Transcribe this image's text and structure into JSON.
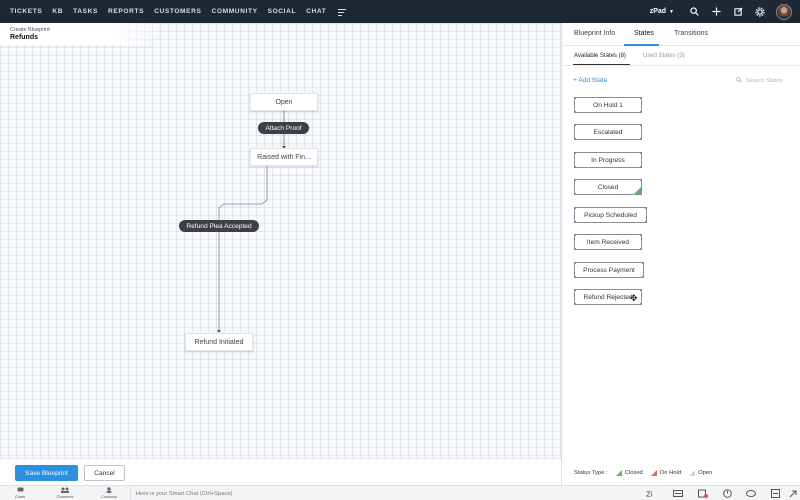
{
  "topnav": {
    "items": [
      "TICKETS",
      "KB",
      "TASKS",
      "REPORTS",
      "CUSTOMERS",
      "COMMUNITY",
      "SOCIAL",
      "CHAT"
    ],
    "portal_name": "zPad",
    "icons": [
      "menu-icon",
      "search-icon",
      "plus-icon",
      "share-icon",
      "gear-icon",
      "avatar"
    ]
  },
  "breadcrumb": {
    "section": "Create Blueprint",
    "title": "Refunds"
  },
  "canvas": {
    "nodes": {
      "open": "Open",
      "raised": "Raised with Fin...",
      "refund_initiated": "Refund Initiated"
    },
    "transitions": {
      "attach_proof": "Attach Proof",
      "refund_plea": "Refund Plea Accepted"
    }
  },
  "actions": {
    "save": "Save Blueprint",
    "cancel": "Cancel"
  },
  "panel": {
    "tabs": [
      "Blueprint Info",
      "States",
      "Transitions"
    ],
    "active_tab": "States",
    "sub_tabs": {
      "available": "Available States (8)",
      "used": "Used States (3)"
    },
    "add_state": "+ Add State",
    "search_placeholder": "Search States",
    "states": [
      "On Hold 1",
      "Escalated",
      "In Progress",
      "Closed",
      "Pickup Scheduled",
      "Item Received",
      "Process Payment",
      "Refund Rejected"
    ],
    "legend": {
      "label": "Status Type :",
      "closed": "Closed",
      "on_hold": "On Hold",
      "open": "Open"
    },
    "colors": {
      "closed": "#5cb85c",
      "on_hold": "#e8664c",
      "open": "#cfd3d8",
      "accent": "#2a90e0"
    }
  },
  "bottombar": {
    "items": [
      "Chats",
      "Channels",
      "Contacts"
    ],
    "chat_placeholder": "Here is your Smart Chat (Ctrl+Space)"
  }
}
